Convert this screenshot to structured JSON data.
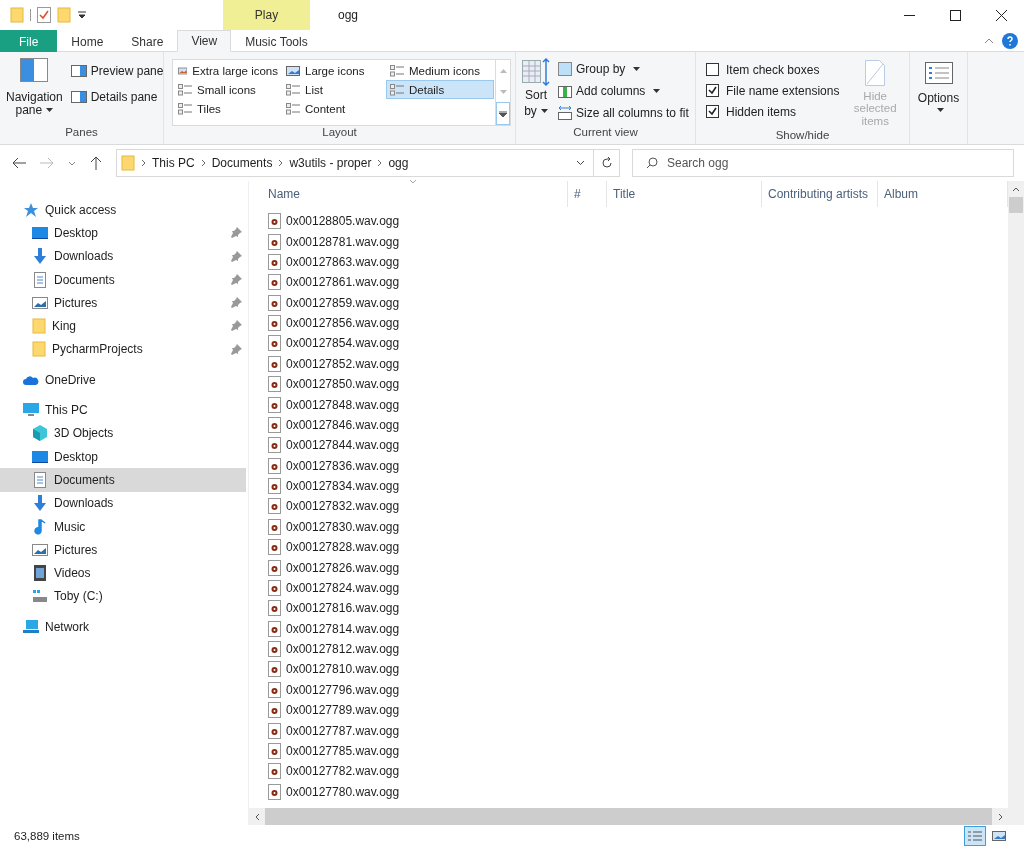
{
  "window": {
    "title": "ogg",
    "context_tab": "Play"
  },
  "ribbon_tabs": [
    {
      "label": "File",
      "kind": "file",
      "selected": false
    },
    {
      "label": "Home",
      "kind": "tab",
      "selected": false
    },
    {
      "label": "Share",
      "kind": "tab",
      "selected": false
    },
    {
      "label": "View",
      "kind": "tab",
      "selected": true
    },
    {
      "label": "Music Tools",
      "kind": "tab",
      "selected": false
    }
  ],
  "panes": {
    "navigation": "Navigation pane",
    "preview": "Preview pane",
    "details": "Details pane",
    "group": "Panes"
  },
  "layout": {
    "options": [
      {
        "label": "Extra large icons",
        "kind": "xl",
        "selected": false
      },
      {
        "label": "Large icons",
        "kind": "large",
        "selected": false
      },
      {
        "label": "Medium icons",
        "kind": "medium",
        "selected": false
      },
      {
        "label": "Small icons",
        "kind": "small",
        "selected": false
      },
      {
        "label": "List",
        "kind": "list",
        "selected": false
      },
      {
        "label": "Details",
        "kind": "details",
        "selected": true
      },
      {
        "label": "Tiles",
        "kind": "tiles",
        "selected": false
      },
      {
        "label": "Content",
        "kind": "content",
        "selected": false
      }
    ],
    "group": "Layout"
  },
  "current_view": {
    "sort": "Sort",
    "sort_by": "by",
    "group_by": "Group by",
    "add_columns": "Add columns",
    "size_columns": "Size all columns to fit",
    "group": "Current view"
  },
  "show_hide": {
    "checkboxes": [
      {
        "label": "Item check boxes",
        "checked": false
      },
      {
        "label": "File name extensions",
        "checked": true
      },
      {
        "label": "Hidden items",
        "checked": true
      }
    ],
    "hide_selected": {
      "line1": "Hide selected",
      "line2": "items",
      "disabled": true
    },
    "group": "Show/hide"
  },
  "options": {
    "label": "Options"
  },
  "breadcrumb": [
    "This PC",
    "Documents",
    "w3utils - proper",
    "ogg"
  ],
  "search": {
    "placeholder": "Search ogg"
  },
  "sidebar": [
    {
      "label": "Quick access",
      "kind": "star",
      "selected": false,
      "children": [
        {
          "label": "Desktop",
          "kind": "desktop",
          "pinned": true,
          "selected": false
        },
        {
          "label": "Downloads",
          "kind": "downloads",
          "pinned": true,
          "selected": false
        },
        {
          "label": "Documents",
          "kind": "documents",
          "pinned": true,
          "selected": false
        },
        {
          "label": "Pictures",
          "kind": "pictures",
          "pinned": true,
          "selected": false
        },
        {
          "label": "King",
          "kind": "folder",
          "pinned": true,
          "selected": false
        },
        {
          "label": "PycharmProjects",
          "kind": "folder",
          "pinned": true,
          "selected": false
        }
      ]
    },
    {
      "label": "OneDrive",
      "kind": "cloud",
      "selected": false
    },
    {
      "label": "This PC",
      "kind": "pc",
      "selected": false,
      "children": [
        {
          "label": "3D Objects",
          "kind": "cube",
          "pinned": false,
          "selected": false
        },
        {
          "label": "Desktop",
          "kind": "desktop",
          "pinned": false,
          "selected": false
        },
        {
          "label": "Documents",
          "kind": "documents",
          "pinned": false,
          "selected": true
        },
        {
          "label": "Downloads",
          "kind": "downloads",
          "pinned": false,
          "selected": false
        },
        {
          "label": "Music",
          "kind": "music",
          "pinned": false,
          "selected": false
        },
        {
          "label": "Pictures",
          "kind": "pictures",
          "pinned": false,
          "selected": false
        },
        {
          "label": "Videos",
          "kind": "videos",
          "pinned": false,
          "selected": false
        },
        {
          "label": "Toby (C:)",
          "kind": "drive",
          "pinned": false,
          "selected": false
        }
      ]
    },
    {
      "label": "Network",
      "kind": "network",
      "selected": false
    }
  ],
  "table": {
    "columns": [
      "Name",
      "#",
      "Title",
      "Contributing artists",
      "Album"
    ],
    "rows": [
      "0x00128805.wav.ogg",
      "0x00128781.wav.ogg",
      "0x00127863.wav.ogg",
      "0x00127861.wav.ogg",
      "0x00127859.wav.ogg",
      "0x00127856.wav.ogg",
      "0x00127854.wav.ogg",
      "0x00127852.wav.ogg",
      "0x00127850.wav.ogg",
      "0x00127848.wav.ogg",
      "0x00127846.wav.ogg",
      "0x00127844.wav.ogg",
      "0x00127836.wav.ogg",
      "0x00127834.wav.ogg",
      "0x00127832.wav.ogg",
      "0x00127830.wav.ogg",
      "0x00127828.wav.ogg",
      "0x00127826.wav.ogg",
      "0x00127824.wav.ogg",
      "0x00127816.wav.ogg",
      "0x00127814.wav.ogg",
      "0x00127812.wav.ogg",
      "0x00127810.wav.ogg",
      "0x00127796.wav.ogg",
      "0x00127789.wav.ogg",
      "0x00127787.wav.ogg",
      "0x00127785.wav.ogg",
      "0x00127782.wav.ogg",
      "0x00127780.wav.ogg"
    ]
  },
  "status_bar": {
    "count": "63,889 items"
  }
}
